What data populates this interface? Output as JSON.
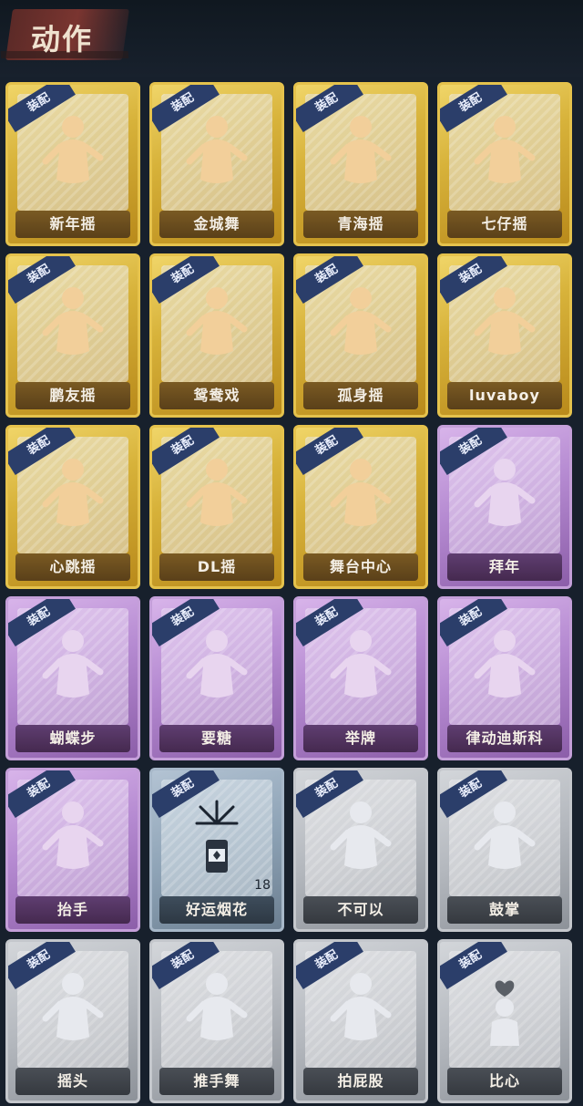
{
  "header": {
    "title": "动作"
  },
  "equip_label": "装配",
  "cards": [
    {
      "name": "新年摇",
      "tier": "gold",
      "icon": "dance-figure-icon"
    },
    {
      "name": "金城舞",
      "tier": "gold",
      "icon": "dance-figure-icon"
    },
    {
      "name": "青海摇",
      "tier": "gold",
      "icon": "dance-figure-icon"
    },
    {
      "name": "七仔摇",
      "tier": "gold",
      "icon": "dance-figure-icon"
    },
    {
      "name": "鹏友摇",
      "tier": "gold",
      "icon": "dance-figure-icon"
    },
    {
      "name": "鸳鸯戏",
      "tier": "gold",
      "icon": "dance-figure-icon"
    },
    {
      "name": "孤身摇",
      "tier": "gold",
      "icon": "dance-figure-icon"
    },
    {
      "name": "luvaboy",
      "tier": "gold",
      "icon": "dance-figure-icon"
    },
    {
      "name": "心跳摇",
      "tier": "gold",
      "icon": "dance-figure-icon"
    },
    {
      "name": "DL摇",
      "tier": "gold",
      "icon": "dance-figure-icon"
    },
    {
      "name": "舞台中心",
      "tier": "gold",
      "icon": "dance-figure-icon"
    },
    {
      "name": "拜年",
      "tier": "purple",
      "icon": "bow-figure-icon"
    },
    {
      "name": "蝴蝶步",
      "tier": "purple",
      "icon": "dance-figure-icon"
    },
    {
      "name": "要糖",
      "tier": "purple",
      "icon": "reach-figure-icon"
    },
    {
      "name": "举牌",
      "tier": "purple",
      "icon": "sign-figure-icon"
    },
    {
      "name": "律动迪斯科",
      "tier": "purple",
      "icon": "disco-figure-icon"
    },
    {
      "name": "抬手",
      "tier": "purple",
      "icon": "raise-hand-icon"
    },
    {
      "name": "好运烟花",
      "tier": "blue",
      "icon": "firework-icon",
      "count": "18"
    },
    {
      "name": "不可以",
      "tier": "gray",
      "icon": "finger-no-icon"
    },
    {
      "name": "鼓掌",
      "tier": "gray",
      "icon": "clap-icon"
    },
    {
      "name": "摇头",
      "tier": "gray",
      "icon": "figure-icon"
    },
    {
      "name": "推手舞",
      "tier": "gray",
      "icon": "figure-icon"
    },
    {
      "name": "拍屁股",
      "tier": "gray",
      "icon": "figure-icon"
    },
    {
      "name": "比心",
      "tier": "gray",
      "icon": "heart-hand-icon"
    }
  ]
}
